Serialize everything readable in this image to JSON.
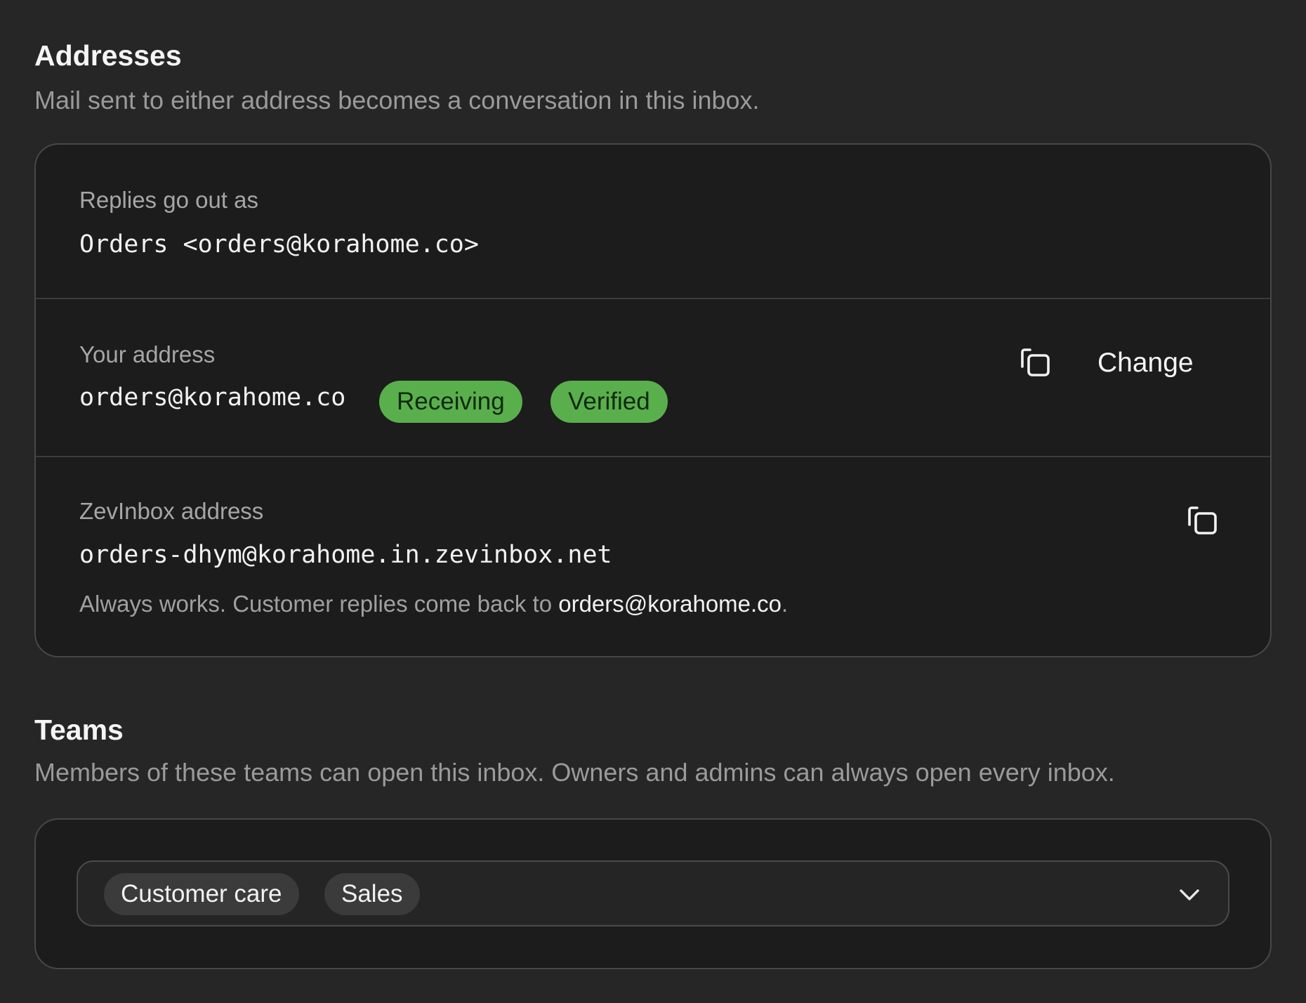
{
  "addresses": {
    "title": "Addresses",
    "description": "Mail sent to either address becomes a conversation in this inbox.",
    "replies": {
      "label": "Replies go out as",
      "value": "Orders <orders@korahome.co>"
    },
    "your_address": {
      "label": "Your address",
      "value": "orders@korahome.co",
      "badges": [
        "Receiving",
        "Verified"
      ],
      "copy_icon": "copy-icon",
      "change_label": "Change"
    },
    "zevinbox": {
      "label": "ZevInbox address",
      "value": "orders-dhym@korahome.in.zevinbox.net",
      "note_prefix": "Always works. Customer replies come back to ",
      "note_address": "orders@korahome.co",
      "note_suffix": ".",
      "copy_icon": "copy-icon"
    }
  },
  "teams": {
    "title": "Teams",
    "description": "Members of these teams can open this inbox. Owners and admins can always open every inbox.",
    "selected": [
      "Customer care",
      "Sales"
    ],
    "dropdown_icon": "chevron-down-icon"
  },
  "colors": {
    "background": "#262626",
    "card": "#1c1c1c",
    "badge_green": "#5aaf4d",
    "chip": "#3b3b3b"
  }
}
